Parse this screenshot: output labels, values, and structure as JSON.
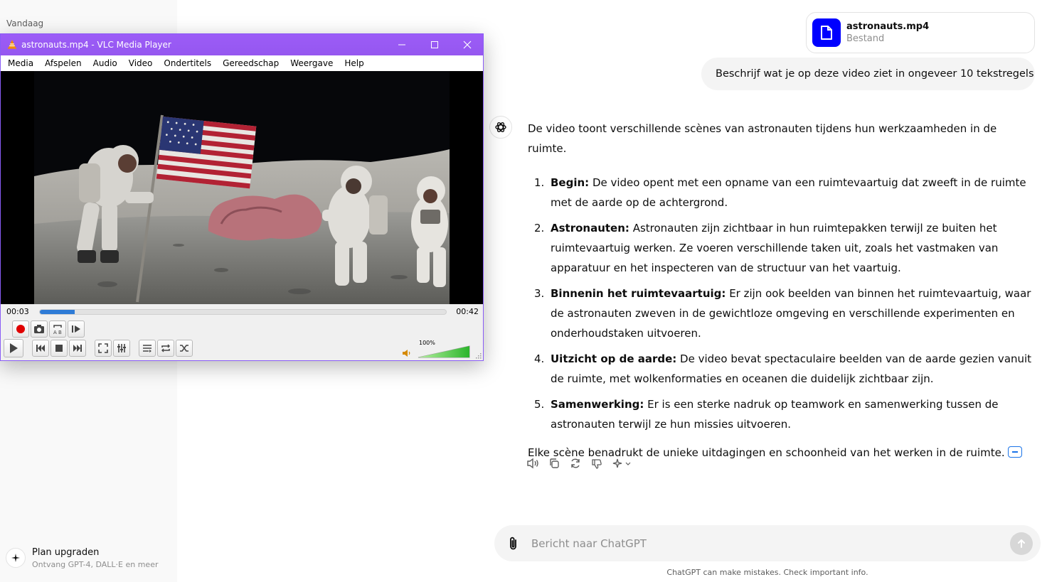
{
  "sidebar": {
    "section_label": "Vandaag",
    "upgrade": {
      "title": "Plan upgraden",
      "subtitle": "Ontvang GPT-4, DALL·E en meer"
    }
  },
  "chat": {
    "file": {
      "name": "astronauts.mp4",
      "type": "Bestand"
    },
    "user_message": "Beschrijf wat je op deze video ziet in ongeveer 10 tekstregels",
    "answer": {
      "intro": "De video toont verschillende scènes van astronauten tijdens hun werkzaamheden in de ruimte.",
      "items": [
        {
          "num": "1.",
          "title": "Begin:",
          "text": " De video opent met een opname van een ruimtevaartuig dat zweeft in de ruimte met de aarde op de achtergrond."
        },
        {
          "num": "2.",
          "title": "Astronauten:",
          "text": " Astronauten zijn zichtbaar in hun ruimtepakken terwijl ze buiten het ruimtevaartuig werken. Ze voeren verschillende taken uit, zoals het vastmaken van apparatuur en het inspecteren van de structuur van het vaartuig."
        },
        {
          "num": "3.",
          "title": "Binnenin het ruimtevaartuig:",
          "text": " Er zijn ook beelden van binnen het ruimtevaartuig, waar de astronauten zweven in de gewichtloze omgeving en verschillende experimenten en onderhoudstaken uitvoeren."
        },
        {
          "num": "4.",
          "title": "Uitzicht op de aarde:",
          "text": " De video bevat spectaculaire beelden van de aarde gezien vanuit de ruimte, met wolkenformaties en oceanen die duidelijk zichtbaar zijn."
        },
        {
          "num": "5.",
          "title": "Samenwerking:",
          "text": " Er is een sterke nadruk op teamwork en samenwerking tussen de astronauten terwijl ze hun missies uitvoeren."
        }
      ],
      "outro": "Elke scène benadrukt de unieke uitdagingen en schoonheid van het werken in de ruimte."
    },
    "composer_placeholder": "Bericht naar ChatGPT",
    "disclaimer": "ChatGPT can make mistakes. Check important info."
  },
  "vlc": {
    "title": "astronauts.mp4 - VLC Media Player",
    "menu": [
      "Media",
      "Afspelen",
      "Audio",
      "Video",
      "Ondertitels",
      "Gereedschap",
      "Weergave",
      "Help"
    ],
    "time_elapsed": "00:03",
    "time_total": "00:42",
    "progress": 0.085,
    "volume_label": "100%",
    "volume": 1.0,
    "accent_color": "#9b59f5"
  }
}
